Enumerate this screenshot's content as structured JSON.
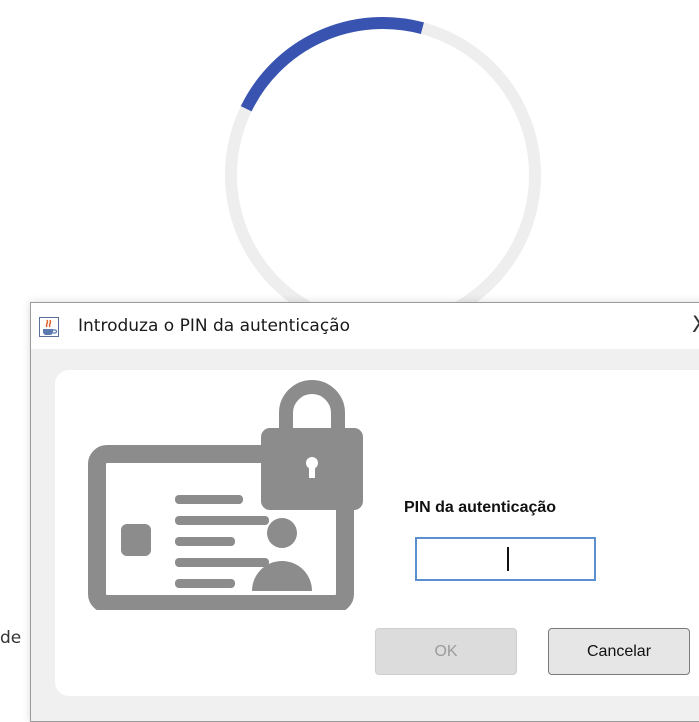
{
  "background": {
    "spinner_progress": 0.22,
    "partial_text": "de"
  },
  "dialog": {
    "title": "Introduza o PIN da autenticação",
    "close_label": "X",
    "pin_label": "PIN da autenticação",
    "pin_value": "",
    "ok_label": "OK",
    "cancel_label": "Cancelar"
  },
  "colors": {
    "spinner_accent": "#3954b0",
    "spinner_track": "#eeeeee",
    "icon_gray": "#8c8c8c",
    "input_border": "#5b8fd0"
  },
  "icons": {
    "window_icon": "java-cup-icon",
    "illustration": "id-card-with-padlock-icon"
  }
}
